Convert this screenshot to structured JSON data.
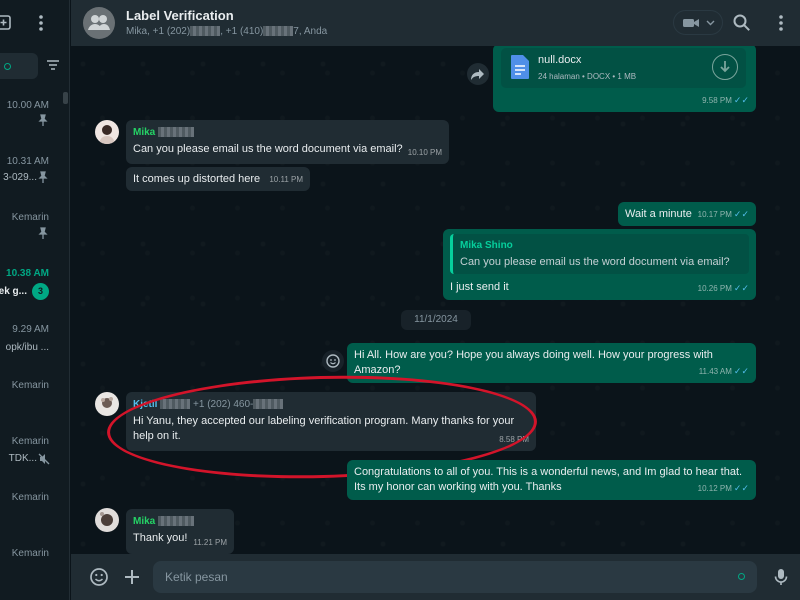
{
  "sidebar": {
    "chats": [
      {
        "time": "10.00 AM",
        "preview": "",
        "pinned": true
      },
      {
        "time": "10.31 AM",
        "preview": "3-029...",
        "pinned": true
      },
      {
        "time": "Kemarin",
        "preview": "",
        "pinned": true
      },
      {
        "time": "10.38 AM",
        "preview": "ek g...",
        "unread": "3",
        "highlight": true
      },
      {
        "time": "9.29 AM",
        "preview": "opk/ibu ..."
      },
      {
        "time": "Kemarin",
        "preview": ""
      },
      {
        "time": "Kemarin",
        "preview": "TDK...",
        "muted": true
      },
      {
        "time": "Kemarin",
        "preview": ""
      },
      {
        "time": "Kemarin",
        "preview": ""
      }
    ]
  },
  "header": {
    "title": "Label Verification",
    "members": [
      "Mika, +1 (202)",
      ", +1 (410)",
      "7, Anda"
    ]
  },
  "messages": {
    "doc": {
      "name": "null.docx",
      "info": "24 halaman • DOCX • 1 MB",
      "time": "9.58 PM"
    },
    "m1": {
      "sender": "Mika",
      "text": "Can you please email us the word document via email?",
      "time": "10.10 PM"
    },
    "m2": {
      "text": "It comes up distorted here",
      "time": "10.11 PM"
    },
    "m3": {
      "text": "Wait a minute",
      "time": "10.17 PM"
    },
    "m4": {
      "quote_sender": "Mika Shino",
      "quote_text": "Can you please email us the word document via email?",
      "text": "I just send it",
      "time": "10.26 PM"
    },
    "date": "11/1/2024",
    "m5": {
      "text": "Hi All. How are you? Hope you always doing well. How your progress with Amazon?",
      "time": "11.43 AM"
    },
    "m6": {
      "sender": "Kjetil",
      "sender_phone": "+1 (202) 460-",
      "text": "Hi Yanu, they accepted our labeling verification program.  Many thanks for your help on it.",
      "time": "8.58 PM"
    },
    "m7": {
      "text": "Congratulations to all of you. This is a wonderful news, and Im glad to hear that. Its my honor can working with you. Thanks",
      "time": "10.12 PM"
    },
    "m8": {
      "sender": "Mika",
      "text": "Thank you!",
      "time": "11.21 PM"
    }
  },
  "composer": {
    "placeholder": "Ketik pesan"
  },
  "colors": {
    "accent": "#00a884",
    "outgoing": "#005c4b",
    "incoming": "#202c33",
    "annotation": "#d3142a"
  }
}
